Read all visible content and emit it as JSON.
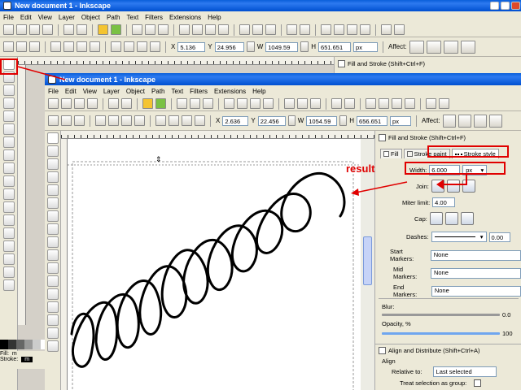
{
  "outer": {
    "title": "New document 1 - Inkscape",
    "menu": [
      "File",
      "Edit",
      "View",
      "Layer",
      "Object",
      "Path",
      "Text",
      "Filters",
      "Extensions",
      "Help"
    ],
    "x_label": "X",
    "x_value": "5.136",
    "y_label": "Y",
    "y_value": "24.956",
    "w_label": "W",
    "w_value": "1049.59",
    "h_label": "H",
    "h_value": "651.651",
    "unit": "px",
    "affect": "Affect:",
    "panel_title": "Fill and Stroke (Shift+Ctrl+F)",
    "fill_label": "Fill:",
    "fill_value": "m",
    "stroke_label": "Stroke:",
    "stroke_value": "m"
  },
  "inner": {
    "title": "New document 1 - Inkscape",
    "menu": [
      "File",
      "Edit",
      "View",
      "Layer",
      "Object",
      "Path",
      "Text",
      "Filters",
      "Extensions",
      "Help"
    ],
    "x_label": "X",
    "x_value": "2.636",
    "y_label": "Y",
    "y_value": "22.456",
    "w_label": "W",
    "w_value": "1054.59",
    "h_label": "H",
    "h_value": "656.651",
    "unit": "px",
    "affect": "Affect:"
  },
  "fill_stroke": {
    "title": "Fill and Stroke (Shift+Ctrl+F)",
    "tabs": [
      "Fill",
      "Stroke paint",
      "Stroke style"
    ],
    "width_label": "Width:",
    "width_value": "6.000",
    "width_unit": "px",
    "join_label": "Join:",
    "miter_label": "Miter limit:",
    "miter_value": "4.00",
    "cap_label": "Cap:",
    "dashes_label": "Dashes:",
    "dashes_value": "0.00",
    "start_markers_label": "Start Markers:",
    "start_markers_value": "None",
    "mid_markers_label": "Mid Markers:",
    "mid_markers_value": "None",
    "end_markers_label": "End Markers:",
    "end_markers_value": "None",
    "blur_label": "Blur:",
    "blur_value": "0.0",
    "opacity_label": "Opacity, %",
    "opacity_value": "100"
  },
  "align": {
    "title": "Align and Distribute (Shift+Ctrl+A)",
    "section": "Align",
    "relative_label": "Relative to:",
    "relative_value": "Last selected",
    "treat_label": "Treat selection as group:"
  },
  "annotation": {
    "result_text": "result",
    "accent_color": "#e00000"
  }
}
